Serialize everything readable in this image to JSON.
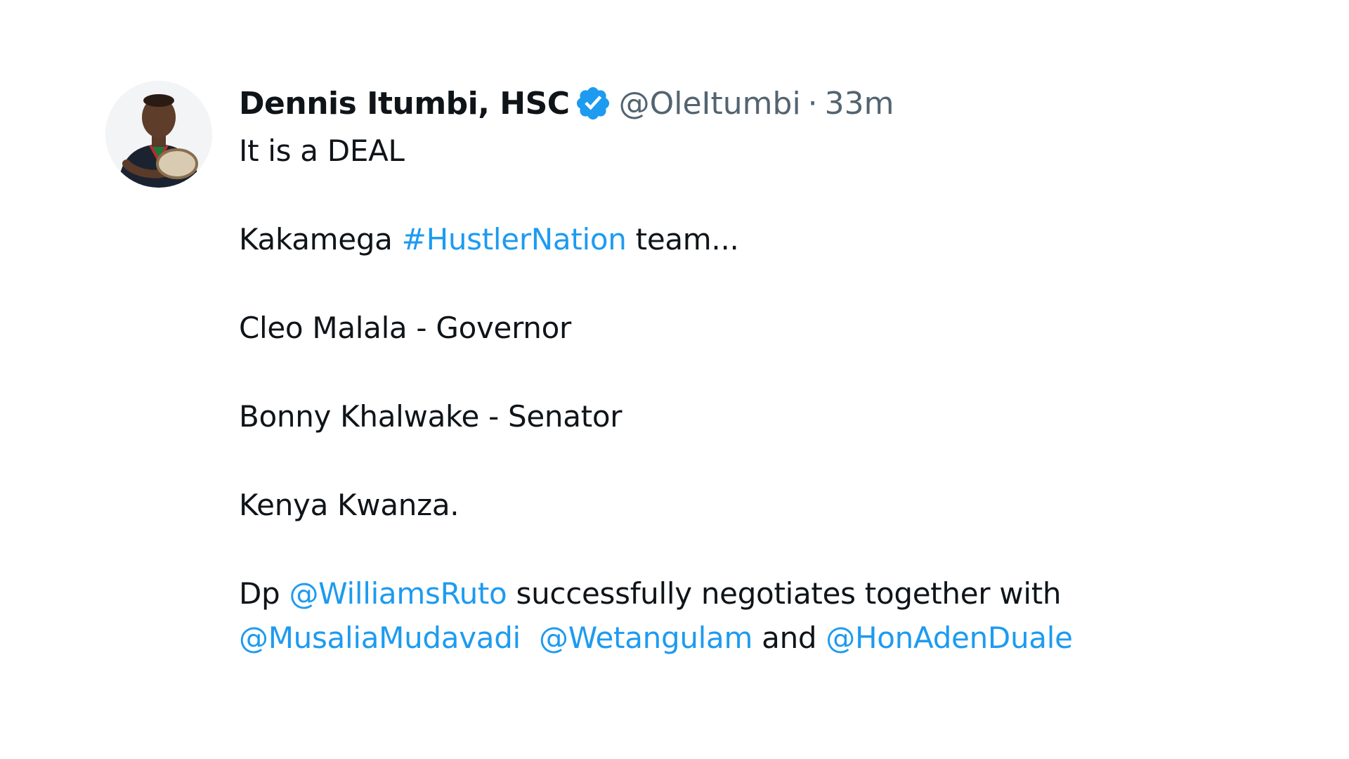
{
  "tweet": {
    "author": {
      "display_name": "Dennis Itumbi, HSC",
      "handle": "@OleItumbi",
      "verified_icon": "verified-badge-icon",
      "avatar_icon": "user-avatar"
    },
    "separator": "·",
    "time": "33m",
    "text": {
      "line1": "It is a DEAL",
      "line2_before": "Kakamega ",
      "line2_hashtag": "#HustlerNation",
      "line2_after": " team...",
      "line3": "Cleo Malala - Governor",
      "line4": "Bonny Khalwake - Senator",
      "line5": "Kenya Kwanza.",
      "line6_before": "Dp ",
      "line6_mention": "@WilliamsRuto",
      "line6_after": " successfully negotiates together with",
      "line7_mention1": "@MusaliaMudavadi",
      "line7_mention2": "@Wetangulam",
      "line7_mid": " and ",
      "line7_mention3": "@HonAdenDuale"
    },
    "colors": {
      "link": "#1d9bf0",
      "verified": "#1d9bf0",
      "secondary_text": "#536471",
      "primary_text": "#0f1419"
    }
  }
}
